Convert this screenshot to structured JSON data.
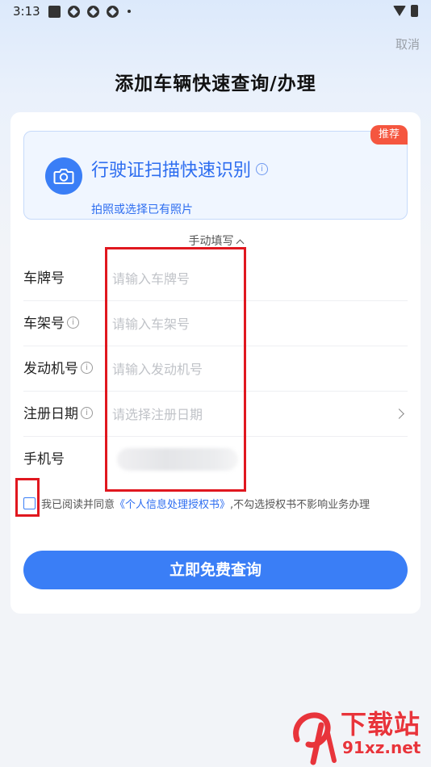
{
  "status_bar": {
    "time": "3:13",
    "icons": [
      "notification-square-icon",
      "app-circle-icon",
      "app-circle-icon",
      "app-circle-icon",
      "dot-icon",
      "wifi-icon",
      "battery-icon"
    ]
  },
  "header": {
    "cancel_label": "取消",
    "title": "添加车辆快速查询/办理"
  },
  "scan": {
    "badge": "推荐",
    "title": "行驶证扫描快速识别",
    "subtitle": "拍照或选择已有照片",
    "icon": "camera-icon"
  },
  "manual_toggle": "手动填写",
  "form": {
    "rows": [
      {
        "label": "车牌号",
        "placeholder": "请输入车牌号",
        "has_info": false
      },
      {
        "label": "车架号",
        "placeholder": "请输入车架号",
        "has_info": true
      },
      {
        "label": "发动机号",
        "placeholder": "请输入发动机号",
        "has_info": true
      },
      {
        "label": "注册日期",
        "placeholder": "请选择注册日期",
        "has_info": true,
        "has_chevron": true
      },
      {
        "label": "手机号",
        "value": "",
        "blurred": true
      }
    ],
    "info_symbol": "i"
  },
  "agreement": {
    "prefix": "我已阅读并同意",
    "link": "《个人信息处理授权书》",
    "suffix": ",不勾选授权书不影响业务办理",
    "checked": false
  },
  "submit_label": "立即免费查询",
  "watermark": {
    "title": "下载站",
    "url": "91xz.net"
  },
  "colors": {
    "accent": "#3a7ef6",
    "link": "#2d6df0",
    "badge": "#f5563f",
    "highlight": "#e0171f"
  }
}
